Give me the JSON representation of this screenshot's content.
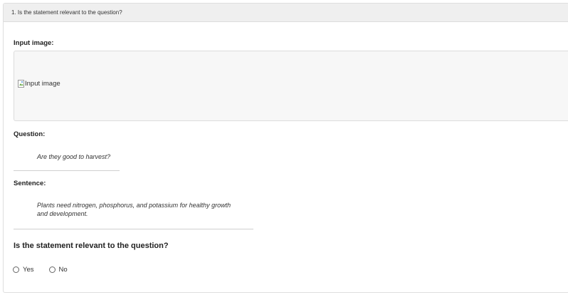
{
  "header": {
    "title": "1. Is the statement relevant to the question?"
  },
  "input_image": {
    "label": "Input image:",
    "alt_text": "Input image",
    "icon": "broken-image-icon"
  },
  "question": {
    "label": "Question:",
    "text": "Are they good to harvest?"
  },
  "sentence": {
    "label": "Sentence:",
    "line1": "Plants need nitrogen, phosphorus, and potassium for healthy growth",
    "line2": "and development."
  },
  "prompt": {
    "text": "Is the statement relevant to the question?"
  },
  "options": {
    "yes": "Yes",
    "no": "No"
  }
}
